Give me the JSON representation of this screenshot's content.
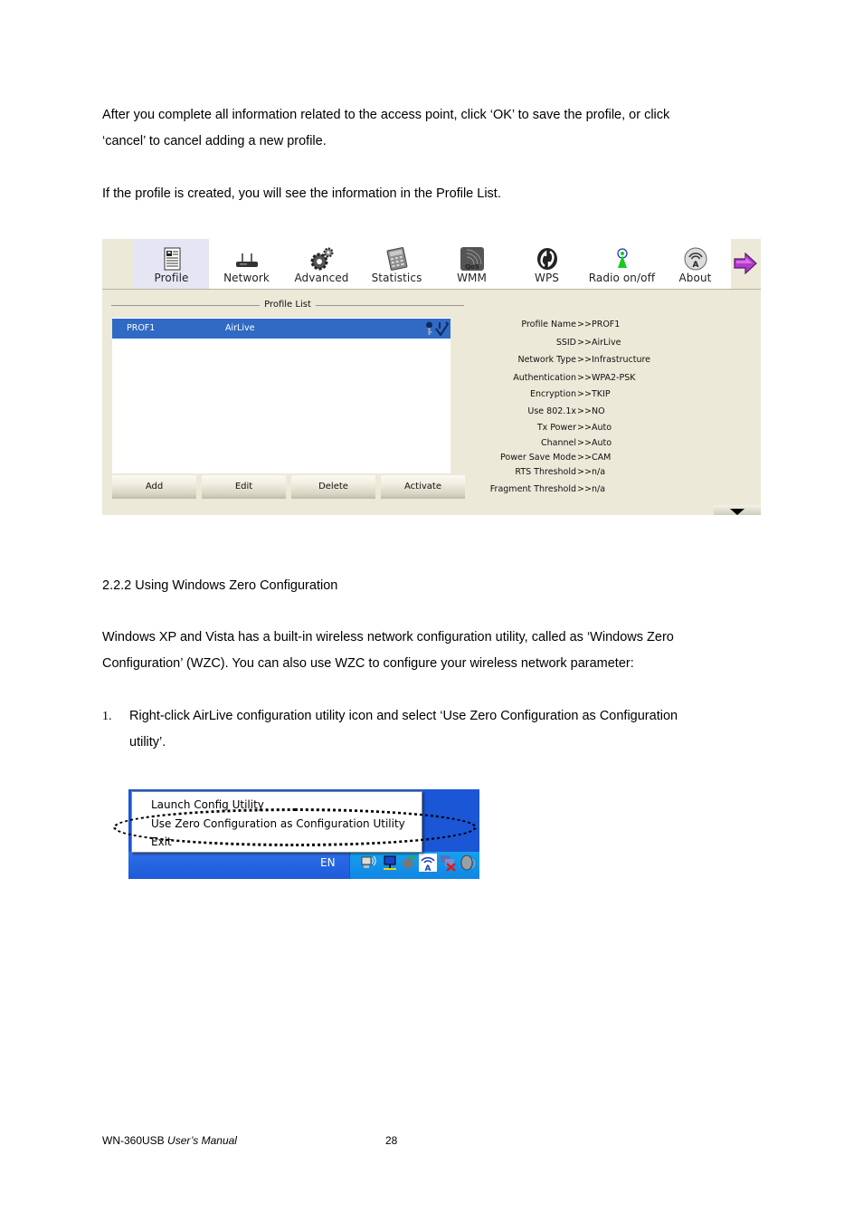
{
  "document": {
    "para1_line1": "After you complete all information related to the access point, click ‘OK’ to save the profile, or click",
    "para1_line2": "‘cancel’ to cancel adding a new profile.",
    "para2": "If the profile is created, you will see the information in the Profile List.",
    "section_heading": "2.2.2 Using Windows Zero Configuration",
    "para3_line1": "Windows XP and Vista has a built-in wireless network configuration utility, called as ‘Windows Zero",
    "para3_line2": "Configuration’ (WZC). You can also use WZC to configure your wireless network parameter:",
    "step1_number": "1.",
    "step1_line1": "Right-click AirLive configuration utility icon and select ‘Use Zero Configuration as Configuration",
    "step1_line2": "utility’.",
    "footer_product": "WN-360USB",
    "footer_manual": "User’s Manual",
    "page_number": "28"
  },
  "utility": {
    "toolbar": [
      {
        "label": "Profile",
        "icon": "profile-icon",
        "active": true
      },
      {
        "label": "Network",
        "icon": "network-icon",
        "active": false
      },
      {
        "label": "Advanced",
        "icon": "advanced-gears-icon",
        "active": false
      },
      {
        "label": "Statistics",
        "icon": "statistics-calculator-icon",
        "active": false
      },
      {
        "label": "WMM",
        "icon": "qos-icon",
        "active": false
      },
      {
        "label": "WPS",
        "icon": "wps-icon",
        "active": false
      },
      {
        "label": "Radio on/off",
        "icon": "radio-antenna-icon",
        "active": false
      },
      {
        "label": "About",
        "icon": "about-icon",
        "active": false
      }
    ],
    "next_arrow_icon": "arrow-right-icon",
    "profile_list_title": "Profile List",
    "profiles": [
      {
        "name": "PROF1",
        "ssid": "AirLive",
        "secured": true,
        "active": true
      }
    ],
    "buttons": {
      "add": "Add",
      "edit": "Edit",
      "delete": "Delete",
      "activate": "Activate"
    },
    "details_separator": ">>",
    "details": [
      {
        "label": "Profile Name",
        "value": "PROF1"
      },
      {
        "label": "SSID",
        "value": "AirLive"
      },
      {
        "label": "Network Type",
        "value": "Infrastructure"
      },
      {
        "label": "Authentication",
        "value": "WPA2-PSK"
      },
      {
        "label": "Encryption",
        "value": "TKIP"
      },
      {
        "label": "Use 802.1x",
        "value": "NO"
      },
      {
        "label": "Tx Power",
        "value": "Auto"
      },
      {
        "label": "Channel",
        "value": "Auto"
      },
      {
        "label": "Power Save Mode",
        "value": "CAM"
      },
      {
        "label": "RTS Threshold",
        "value": "n/a"
      },
      {
        "label": "Fragment Threshold",
        "value": "n/a"
      }
    ],
    "colors": {
      "selection": "#316ac5",
      "panel": "#ece9d8",
      "active_tab": "#e6e5f4"
    }
  },
  "tray": {
    "menu_items": [
      "Launch Config Utility",
      "Use Zero Configuration as Configuration Utility",
      "Exit"
    ],
    "highlighted_item": "Use Zero Configuration as Configuration Utility",
    "language": "EN",
    "tray_icons": [
      "wireless-connection-icon",
      "network-computer-icon",
      "safely-remove-icon",
      "airlive-utility-icon",
      "network-disconnected-icon",
      "volume-icon"
    ],
    "colors": {
      "taskbar": "#1d5ad8",
      "notification_area": "#0f86e3"
    }
  }
}
